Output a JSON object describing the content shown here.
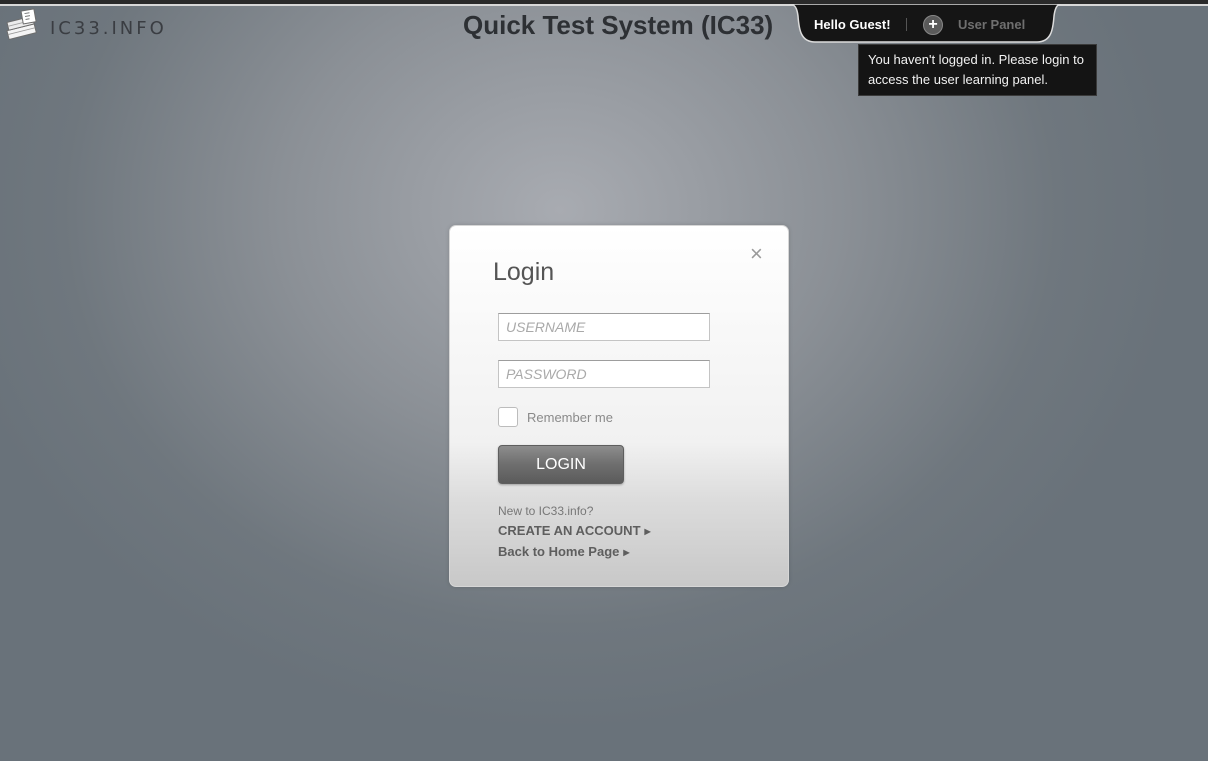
{
  "header": {
    "logo_text": "IC33.INFO",
    "site_title": "Quick Test System (IC33)",
    "greeting": "Hello Guest!",
    "user_panel_label": "User Panel",
    "user_panel_icon": "plus-icon"
  },
  "tooltip": {
    "text": "You haven't logged in. Please login to access the user learning panel."
  },
  "login": {
    "title": "Login",
    "close_icon": "×",
    "username_placeholder": "USERNAME",
    "password_placeholder": "PASSWORD",
    "remember_label": "Remember me",
    "remember_checked": false,
    "submit_label": "LOGIN",
    "new_user_text": "New to IC33.info?",
    "create_account_label": "CREATE AN ACCOUNT",
    "back_home_label": "Back to Home Page"
  }
}
